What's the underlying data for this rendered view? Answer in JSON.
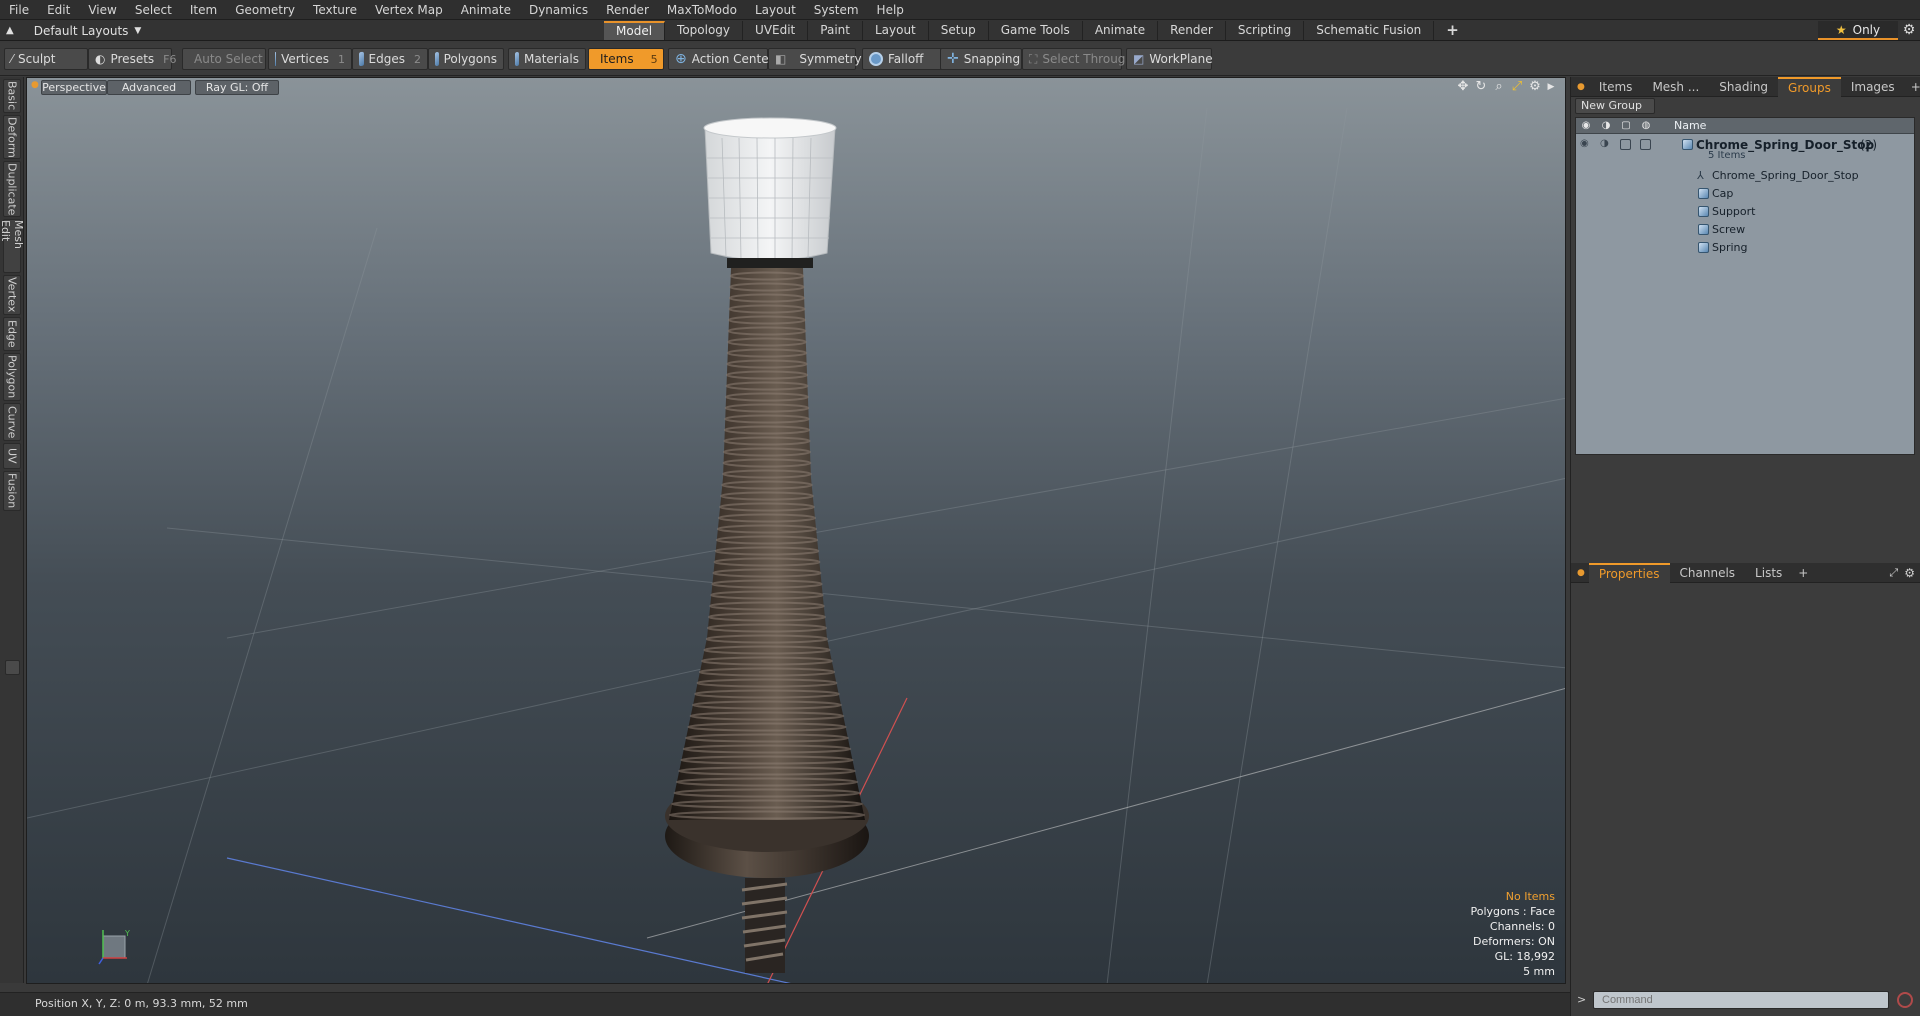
{
  "menu": [
    "File",
    "Edit",
    "View",
    "Select",
    "Item",
    "Geometry",
    "Texture",
    "Vertex Map",
    "Animate",
    "Dynamics",
    "Render",
    "MaxToModo",
    "Layout",
    "System",
    "Help"
  ],
  "layout_dropdown": "Default Layouts",
  "layout_tabs": [
    {
      "label": "Model",
      "active": true
    },
    {
      "label": "Topology"
    },
    {
      "label": "UVEdit"
    },
    {
      "label": "Paint"
    },
    {
      "label": "Layout"
    },
    {
      "label": "Setup"
    },
    {
      "label": "Game Tools"
    },
    {
      "label": "Animate"
    },
    {
      "label": "Render"
    },
    {
      "label": "Scripting"
    },
    {
      "label": "Schematic Fusion"
    }
  ],
  "add_tab": "+",
  "only_label": "Only",
  "toolbar": {
    "sculpt": "Sculpt",
    "presets": "Presets",
    "presets_key": "F6",
    "auto_select": "Auto Select",
    "vertices": "Vertices",
    "vertices_key": "1",
    "edges": "Edges",
    "edges_key": "2",
    "polygons": "Polygons",
    "materials": "Materials",
    "items": "Items",
    "items_key": "5",
    "action_center": "Action Center",
    "symmetry": "Symmetry",
    "falloff": "Falloff",
    "snapping": "Snapping",
    "select_through": "Select Through",
    "workplane": "WorkPlane"
  },
  "left_tabs": [
    "Basic",
    "Deform",
    "Duplicate",
    "Mesh Edit",
    "Vertex",
    "Edge",
    "Polygon",
    "Curve",
    "UV",
    "Fusion"
  ],
  "viewport": {
    "perspective": "Perspective",
    "advanced": "Advanced",
    "raygl": "Ray GL: Off",
    "info": {
      "selection": "No Items",
      "polygons": "Polygons : Face",
      "channels": "Channels: 0",
      "deformers": "Deformers: ON",
      "gl": "GL: 18,992",
      "grid": "5 mm"
    },
    "axis_y_label": "Y"
  },
  "status": {
    "position": "Position X, Y, Z:   0 m, 93.3 mm, 52 mm"
  },
  "right_tabs": [
    {
      "label": "Items"
    },
    {
      "label": "Mesh ..."
    },
    {
      "label": "Shading"
    },
    {
      "label": "Groups",
      "active": true
    },
    {
      "label": "Images"
    },
    {
      "label": "+"
    }
  ],
  "groups": {
    "new_group": "New Group",
    "name_header": "Name",
    "group_name": "Chrome_Spring_Door_Stop",
    "group_count": "(2)",
    "item_count": "5 Items",
    "members": [
      {
        "label": "Chrome_Spring_Door_Stop",
        "icon": "locator-icon"
      },
      {
        "label": "Cap",
        "icon": "mesh-icon"
      },
      {
        "label": "Support",
        "icon": "mesh-icon"
      },
      {
        "label": "Screw",
        "icon": "mesh-icon"
      },
      {
        "label": "Spring",
        "icon": "mesh-icon"
      }
    ]
  },
  "props_tabs": [
    {
      "label": "Properties",
      "active": true
    },
    {
      "label": "Channels"
    },
    {
      "label": "Lists"
    },
    {
      "label": "+"
    }
  ],
  "command": {
    "placeholder": "Command",
    "prompt": ">"
  },
  "colors": {
    "accent": "#f09a2a",
    "viewport_top": "#8a9399",
    "viewport_bottom": "#2e363d"
  }
}
